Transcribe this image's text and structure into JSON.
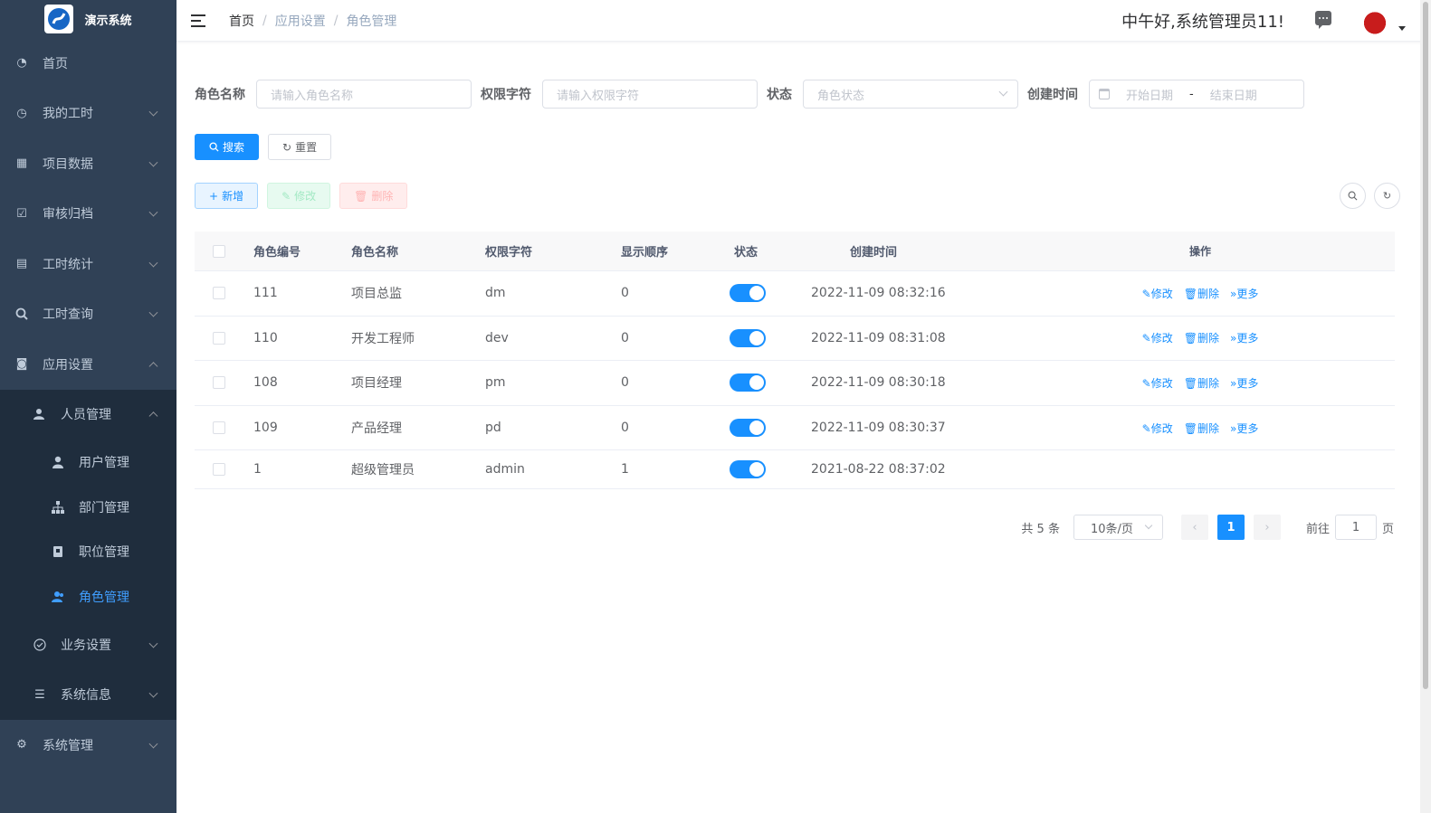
{
  "app": {
    "name": "演示系统"
  },
  "sidebar": {
    "items": [
      {
        "label": "首页",
        "icon": "dashboard-icon"
      },
      {
        "label": "我的工时",
        "icon": "clock-icon"
      },
      {
        "label": "项目数据",
        "icon": "table-icon"
      },
      {
        "label": "审核归档",
        "icon": "checkbox-icon"
      },
      {
        "label": "工时统计",
        "icon": "chart-icon"
      },
      {
        "label": "工时查询",
        "icon": "search-icon"
      },
      {
        "label": "应用设置",
        "icon": "settings-box-icon"
      }
    ],
    "sub_group": {
      "label": "人员管理",
      "icon": "peoples-icon"
    },
    "sub_items": [
      {
        "label": "用户管理",
        "icon": "user-icon"
      },
      {
        "label": "部门管理",
        "icon": "tree-icon"
      },
      {
        "label": "职位管理",
        "icon": "post-icon"
      },
      {
        "label": "角色管理",
        "icon": "role-icon",
        "active": true
      }
    ],
    "after_items": [
      {
        "label": "业务设置",
        "icon": "check-circle-icon"
      },
      {
        "label": "系统信息",
        "icon": "list-icon"
      }
    ],
    "system": {
      "label": "系统管理",
      "icon": "gear-icon"
    }
  },
  "header": {
    "breadcrumb": [
      "首页",
      "应用设置",
      "角色管理"
    ],
    "greeting": "中午好,系统管理员11!"
  },
  "search": {
    "role_name_label": "角色名称",
    "role_name_placeholder": "请输入角色名称",
    "role_key_label": "权限字符",
    "role_key_placeholder": "请输入权限字符",
    "status_label": "状态",
    "status_placeholder": "角色状态",
    "time_label": "创建时间",
    "start_placeholder": "开始日期",
    "range_sep": "-",
    "end_placeholder": "结束日期",
    "search_btn": "搜索",
    "reset_btn": "重置"
  },
  "toolbar": {
    "add": "新增",
    "edit": "修改",
    "delete": "删除"
  },
  "table": {
    "headers": [
      "角色编号",
      "角色名称",
      "权限字符",
      "显示顺序",
      "状态",
      "创建时间",
      "操作"
    ],
    "rows": [
      {
        "id": "111",
        "name": "项目总监",
        "key": "dm",
        "sort": "0",
        "status_on": true,
        "time": "2022-11-09 08:32:16",
        "ops": true
      },
      {
        "id": "110",
        "name": "开发工程师",
        "key": "dev",
        "sort": "0",
        "status_on": true,
        "time": "2022-11-09 08:31:08",
        "ops": true
      },
      {
        "id": "108",
        "name": "项目经理",
        "key": "pm",
        "sort": "0",
        "status_on": true,
        "time": "2022-11-09 08:30:18",
        "ops": true
      },
      {
        "id": "109",
        "name": "产品经理",
        "key": "pd",
        "sort": "0",
        "status_on": true,
        "time": "2022-11-09 08:30:37",
        "ops": true
      },
      {
        "id": "1",
        "name": "超级管理员",
        "key": "admin",
        "sort": "1",
        "status_on": true,
        "time": "2021-08-22 08:37:02",
        "ops": false
      }
    ],
    "op_labels": {
      "edit": "修改",
      "delete": "删除",
      "more": "更多"
    }
  },
  "pagination": {
    "total": "共 5 条",
    "page_size": "10条/页",
    "current": "1",
    "goto_label": "前往",
    "goto_value": "1",
    "page_unit": "页"
  },
  "colors": {
    "primary": "#1890ff",
    "sidebar_bg": "#304156",
    "submenu_bg": "#1f2d3d"
  }
}
